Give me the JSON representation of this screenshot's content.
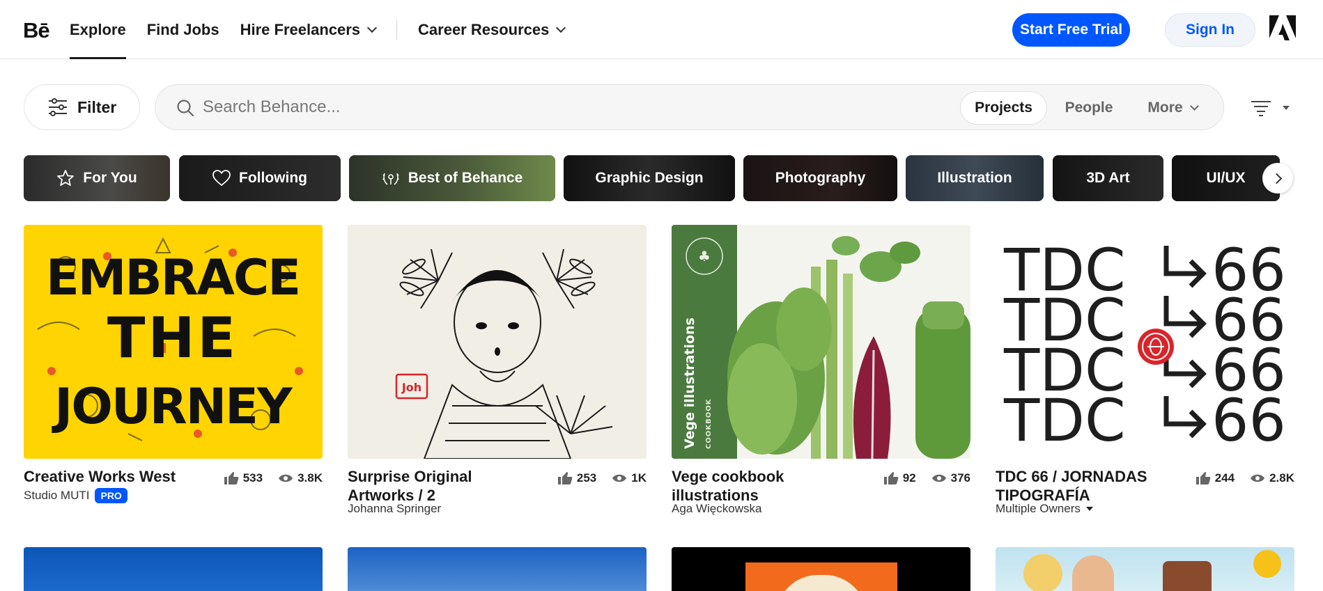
{
  "header": {
    "logo": "Bē",
    "nav": [
      {
        "label": "Explore",
        "active": true,
        "dropdown": false
      },
      {
        "label": "Find Jobs",
        "active": false,
        "dropdown": false
      },
      {
        "label": "Hire Freelancers",
        "active": false,
        "dropdown": true
      },
      {
        "label": "Career Resources",
        "active": false,
        "dropdown": true
      }
    ],
    "start_trial_label": "Start Free Trial",
    "sign_in_label": "Sign In",
    "brand_icon": "adobe-logo-icon"
  },
  "toolbar": {
    "filter_label": "Filter",
    "search_placeholder": "Search Behance...",
    "segments": [
      "Projects",
      "People",
      "More"
    ],
    "selected_segment": "Projects",
    "sort_icon": "sort-lines-icon"
  },
  "categories": [
    {
      "label": "For You",
      "icon": "star-outline-icon"
    },
    {
      "label": "Following",
      "icon": "heart-outline-icon"
    },
    {
      "label": "Best of Behance",
      "icon": "laurel-icon"
    },
    {
      "label": "Graphic Design",
      "icon": ""
    },
    {
      "label": "Photography",
      "icon": ""
    },
    {
      "label": "Illustration",
      "icon": ""
    },
    {
      "label": "3D Art",
      "icon": ""
    },
    {
      "label": "UI/UX",
      "icon": ""
    }
  ],
  "projects": [
    {
      "title": "Creative Works West",
      "owner": "Studio MUTI",
      "badge": "PRO",
      "likes": "533",
      "views": "3.8K",
      "owner_dropdown": false,
      "thumb_text": "EMBRACE THE JOURNEY"
    },
    {
      "title": "Surprise Original Artworks / 2",
      "owner": "Johanna Springer",
      "badge": "",
      "likes": "253",
      "views": "1K",
      "owner_dropdown": false,
      "thumb_text": "Joh"
    },
    {
      "title": "Vege cookbook illustrations",
      "owner": "Aga Więckowska",
      "badge": "",
      "likes": "92",
      "views": "376",
      "owner_dropdown": false,
      "thumb_text": "Vege illustrations",
      "thumb_subtext": "COOKBOOK"
    },
    {
      "title": "TDC 66 / JORNADAS TIPOGRAFÍA",
      "owner": "Multiple Owners",
      "badge": "",
      "likes": "244",
      "views": "2.8K",
      "owner_dropdown": true,
      "thumb_text": "TDC",
      "thumb_text_2": "66"
    }
  ],
  "colors": {
    "accent": "#0057ff",
    "muti_yellow": "#ffd400",
    "vege_green": "#4b7a3f",
    "tdc_red": "#d8252b"
  }
}
